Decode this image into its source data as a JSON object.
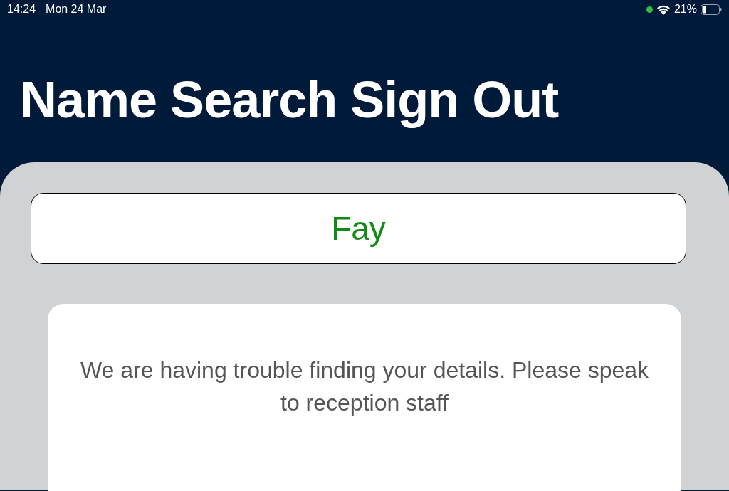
{
  "status_bar": {
    "time": "14:24",
    "date": "Mon 24 Mar",
    "battery": "21%"
  },
  "header": {
    "title": "Name Search Sign Out"
  },
  "name_field": {
    "value": "Fay"
  },
  "message": {
    "text": "We are having trouble finding your details. Please speak to reception staff"
  }
}
